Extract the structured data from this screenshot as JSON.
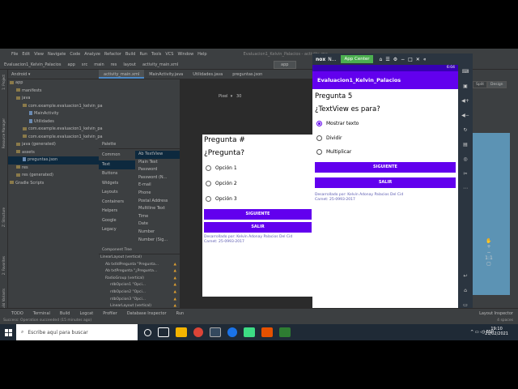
{
  "ide": {
    "menu": [
      "File",
      "Edit",
      "View",
      "Navigate",
      "Code",
      "Analyze",
      "Refactor",
      "Build",
      "Run",
      "Tools",
      "VCS",
      "Window",
      "Help"
    ],
    "window_title": "Evaluacion1_Kelvin_Palacios - activity_ma...",
    "breadcrumb": [
      "Evaluacion1_Kelvin_Palacios",
      "app",
      "src",
      "main",
      "res",
      "layout",
      "activity_main.xml"
    ],
    "run_config": "app",
    "project_view": "Android",
    "tree": [
      {
        "label": "app",
        "type": "folder"
      },
      {
        "label": "manifests",
        "type": "folder"
      },
      {
        "label": "java",
        "type": "folder"
      },
      {
        "label": "com.example.evaluacion1_kelvin_pa",
        "type": "folder"
      },
      {
        "label": "MainActivity",
        "type": "file"
      },
      {
        "label": "Utilidades",
        "type": "file"
      },
      {
        "label": "com.example.evaluacion1_kelvin_pa",
        "type": "folder"
      },
      {
        "label": "com.example.evaluacion1_kelvin_pa",
        "type": "folder"
      },
      {
        "label": "java (generated)",
        "type": "folder"
      },
      {
        "label": "assets",
        "type": "folder"
      },
      {
        "label": "preguntas.json",
        "type": "file",
        "selected": true
      },
      {
        "label": "res",
        "type": "folder"
      },
      {
        "label": "res (generated)",
        "type": "folder"
      },
      {
        "label": "Gradle Scripts",
        "type": "folder"
      }
    ],
    "tabs": [
      "activity_main.xml",
      "MainActivity.java",
      "Utilidades.java",
      "preguntas.json"
    ],
    "palette": {
      "title": "Palette",
      "categories": [
        "Common",
        "Text",
        "Buttons",
        "Widgets",
        "Layouts",
        "Containers",
        "Helpers",
        "Google",
        "Legacy"
      ],
      "selected_category": "Text",
      "items": [
        "Ab TextView",
        "Plain Text",
        "Password",
        "Password (N...",
        "E-mail",
        "Phone",
        "Postal Address",
        "Multiline Text",
        "Time",
        "Date",
        "Number",
        "Number (Sig..."
      ]
    },
    "component_tree": {
      "title": "Component Tree",
      "rows": [
        "LinearLayout (vertical)",
        "Ab txtIdPregunta \"Pregunta...",
        "Ab txtPregunta \"¿Pregunta...",
        "RadioGroup (vertical)",
        "rdbOpcion1 \"Opci...",
        "rdbOpcion2 \"Opci...",
        "rdbOpcion3 \"Opci...",
        "LinearLayout (vertical)",
        "btnSiguiente",
        "btnSalir \"Salir\"",
        "Ab txtView3 \"Desarrolla...",
        "Ab txtView4 \"Carnet: 25..."
      ]
    },
    "design_toolbar": {
      "device": "Pixel",
      "api": "30"
    },
    "split_buttons": [
      "Split",
      "Design"
    ],
    "bottom_tools": [
      "TODO",
      "Terminal",
      "Build",
      "Logcat",
      "Profiler",
      "Database Inspector",
      "Run",
      "Layout Inspector"
    ],
    "status_text": "Success: Operation succeeded (15 minutes ago)",
    "status_right": "4 spaces"
  },
  "design_preview": {
    "title": "Pregunta #",
    "question": "¿Pregunta?",
    "options": [
      "Opción 1",
      "Opción 2",
      "Opción 3"
    ],
    "btn_next": "SIGUIENTE",
    "btn_exit": "SALIR",
    "footer1": "Desarrollado por: Kelvin Adonay Palacios Del Cid",
    "footer2": "Carnet: 25-0993-2017"
  },
  "emulator": {
    "brand": "nox",
    "brand_suffix": "N...",
    "app_center": "App Center",
    "clock": "6:04",
    "app_title": "Evaluacion1_Kelvin_Palacios",
    "title": "Pregunta 5",
    "question": "¿TextView es para?",
    "options": [
      "Mostrar texto",
      "Dividir",
      "Multiplicar"
    ],
    "selected_option": 0,
    "btn_next": "SIGUIENTE",
    "btn_exit": "SALIR",
    "footer1": "Desarrollado por: Kelvin Adonay Palacios Del Cid",
    "footer2": "Carnet: 25-0993-2017"
  },
  "taskbar": {
    "search_placeholder": "Escribe aquí para buscar",
    "language": "ESP",
    "time": "19:10",
    "date": "21/02/2021"
  },
  "colors": {
    "accent": "#6200ee",
    "status": "#3700b3",
    "ide_bg": "#3c3f41"
  }
}
